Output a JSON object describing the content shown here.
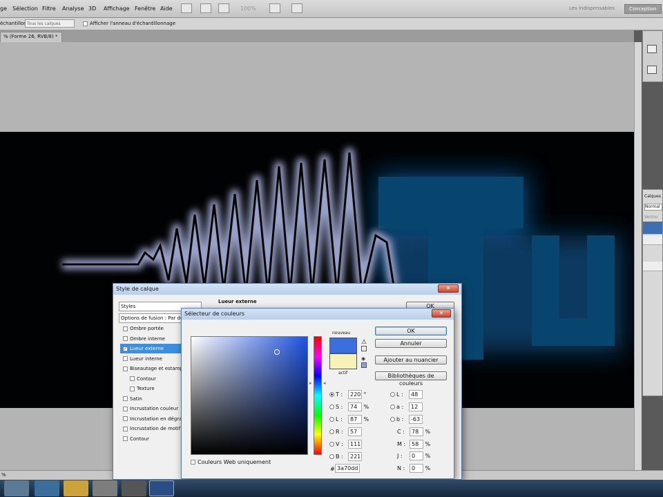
{
  "menubar": {
    "items": [
      "ge",
      "Sélection",
      "Filtre",
      "Analyse",
      "3D",
      "Affichage",
      "Fenêtre",
      "Aide"
    ],
    "zoom": "100%",
    "workspaces": [
      "Les indispensables",
      "Conception"
    ]
  },
  "options_bar": {
    "sample_label": "échantillon :",
    "sample_value": "Tous les calques",
    "ring_label": "Afficher l'anneau d'échantillonnage"
  },
  "document_tab": "% (Forme 26, RVB/8) *",
  "status_zoom": "%",
  "layers_panel": {
    "title": "Calques",
    "blend": "Normal",
    "lock_label": "Verrou"
  },
  "layer_style": {
    "title": "Style de calque",
    "list_header": "Styles",
    "blend_options": "Options de fusion : Par défaut",
    "items": [
      {
        "label": "Ombre portée",
        "checked": false,
        "indent": false,
        "selected": false
      },
      {
        "label": "Ombre interne",
        "checked": false,
        "indent": false,
        "selected": false
      },
      {
        "label": "Lueur externe",
        "checked": true,
        "indent": false,
        "selected": true
      },
      {
        "label": "Lueur interne",
        "checked": false,
        "indent": false,
        "selected": false
      },
      {
        "label": "Biseautage et estampage",
        "checked": false,
        "indent": false,
        "selected": false
      },
      {
        "label": "Contour",
        "checked": false,
        "indent": true,
        "selected": false
      },
      {
        "label": "Texture",
        "checked": false,
        "indent": true,
        "selected": false
      },
      {
        "label": "Satin",
        "checked": false,
        "indent": false,
        "selected": false
      },
      {
        "label": "Incrustation couleur",
        "checked": false,
        "indent": false,
        "selected": false
      },
      {
        "label": "Incrustation en dégradé",
        "checked": false,
        "indent": false,
        "selected": false
      },
      {
        "label": "Incrustation de motif",
        "checked": false,
        "indent": false,
        "selected": false
      },
      {
        "label": "Contour",
        "checked": false,
        "indent": false,
        "selected": false
      }
    ],
    "section_title": "Lueur externe",
    "ok": "OK"
  },
  "color_picker": {
    "title": "Sélecteur de couleurs",
    "new_label": "nouveau",
    "current_label": "actif",
    "new_color": "#3a70dd",
    "current_color": "#f7f3b8",
    "web_only_label": "Couleurs Web uniquement",
    "ok": "OK",
    "cancel": "Annuler",
    "add_swatch": "Ajouter au nuancier",
    "libraries": "Bibliothèques de couleurs",
    "hsb": [
      {
        "key": "T",
        "value": "220",
        "unit": "°",
        "selected": true
      },
      {
        "key": "S",
        "value": "74",
        "unit": "%",
        "selected": false
      },
      {
        "key": "L",
        "value": "87",
        "unit": "%",
        "selected": false
      }
    ],
    "rgb": [
      {
        "key": "R",
        "value": "57"
      },
      {
        "key": "V",
        "value": "111"
      },
      {
        "key": "B",
        "value": "221"
      }
    ],
    "lab": [
      {
        "key": "L",
        "value": "48"
      },
      {
        "key": "a",
        "value": "12"
      },
      {
        "key": "b",
        "value": "-63"
      }
    ],
    "cmyk": [
      {
        "key": "C",
        "value": "78",
        "unit": "%"
      },
      {
        "key": "M",
        "value": "58",
        "unit": "%"
      },
      {
        "key": "J",
        "value": "0",
        "unit": "%"
      },
      {
        "key": "N",
        "value": "0",
        "unit": "%"
      }
    ],
    "hex_label": "#",
    "hex": "3a70dd"
  },
  "colors": {
    "glow": "#8c93b8",
    "text_blue": "#07456e"
  }
}
